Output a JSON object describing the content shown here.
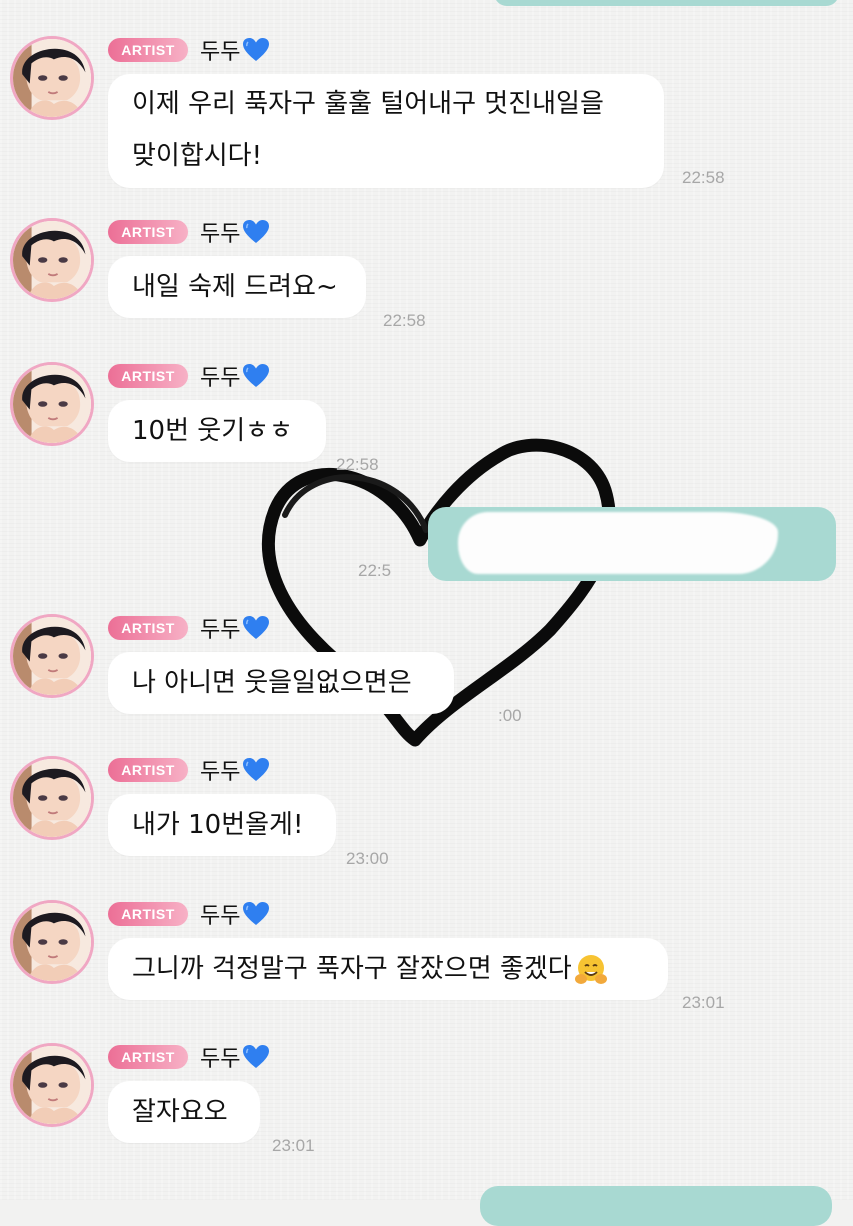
{
  "badge_label": "ARTIST",
  "sender_name": "두두",
  "colors": {
    "badge_start": "#ec6f96",
    "badge_end": "#f7b1c6",
    "my_bubble": "#a8d9d2",
    "heart_emoji": "#2f7ff0"
  },
  "icons": {
    "name_suffix": "blue-heart-emoji",
    "hug": "hugging-face-emoji"
  },
  "messages": [
    {
      "text_lines": [
        "이제 우리 푹자구 훌훌 털어내구 멋진내일을",
        "맞이합시다!"
      ],
      "time": "22:58"
    },
    {
      "text_lines": [
        "내일 숙제 드려요~"
      ],
      "time": "22:58"
    },
    {
      "text_lines": [
        "10번 웃기ㅎㅎ"
      ],
      "time": "22:58"
    },
    {
      "text_lines": [
        "나 아니면 웃을일없으면은"
      ],
      "time": ":00"
    },
    {
      "text_lines": [
        "내가 10번올게!"
      ],
      "time": "23:00"
    },
    {
      "text_lines": [
        "그니까 걱정말구 푹자구 잘잤으면 좋겠다"
      ],
      "time": "23:01"
    },
    {
      "text_lines": [
        "잘자요오"
      ],
      "time": "23:01"
    }
  ],
  "my_message": {
    "time": "22:5"
  }
}
